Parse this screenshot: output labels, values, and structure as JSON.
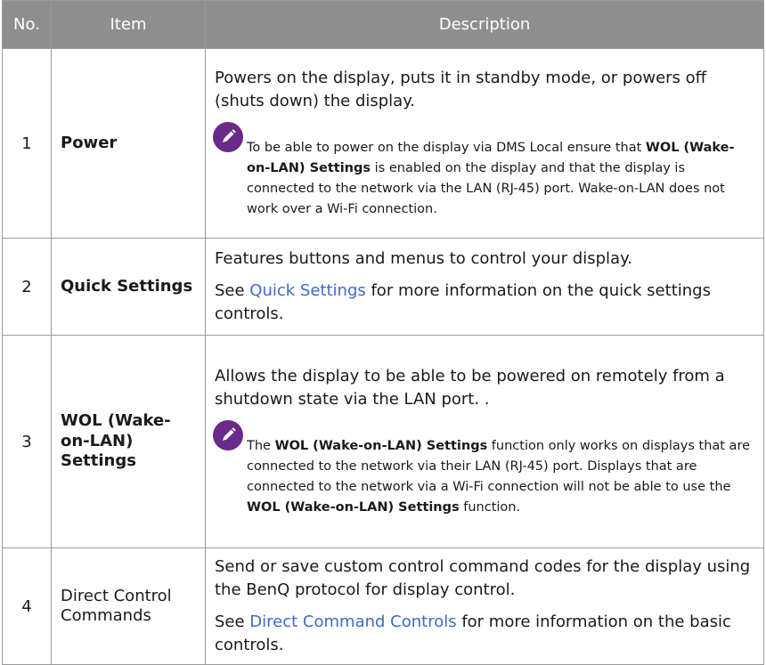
{
  "table": {
    "headers": {
      "no": "No.",
      "item": "Item",
      "description": "Description"
    },
    "rows": [
      {
        "no": "1",
        "item": "Power",
        "desc": "Powers on the display, puts it in standby mode, or powers off (shuts down) the display.",
        "note": {
          "icon": "note-pencil-icon",
          "t1": "To be able to power on the display via DMS Local ensure that ",
          "b1": "WOL (Wake-on-LAN) Settings",
          "t2": " is enabled on the display and that the display is connected to the network via the LAN (RJ-45) port. Wake-on-LAN does not work over a Wi-Fi connection."
        }
      },
      {
        "no": "2",
        "item": "Quick Settings",
        "desc": "Features buttons and menus to control your display.",
        "see_pre": "See ",
        "see_link": "Quick Settings",
        "see_post": " for more information on the quick settings controls."
      },
      {
        "no": "3",
        "item": "WOL (Wake-on-LAN) Settings",
        "desc": "Allows the display to be able to be powered on remotely from a shutdown state via the LAN port. .",
        "note": {
          "icon": "note-pencil-icon",
          "t1": "The ",
          "b1": "WOL (Wake-on-LAN) Settings",
          "t2": " function only works on displays that are connected to the network via their LAN (RJ-45) port. Displays that are connected to the network via a Wi-Fi connection will not be able to use the ",
          "b2": "WOL (Wake-on-LAN) Settings",
          "t3": " function."
        }
      },
      {
        "no": "4",
        "item": "Direct Control Commands",
        "desc": "Send or save custom control command codes for the display using the BenQ protocol for display control.",
        "see_pre": "See ",
        "see_link": "Direct Command Controls",
        "see_post": " for more information on the basic controls."
      }
    ]
  },
  "colors": {
    "header_bg": "#8e8e8e",
    "link": "#3d6ac7",
    "note_icon": "#6a2a8a"
  }
}
